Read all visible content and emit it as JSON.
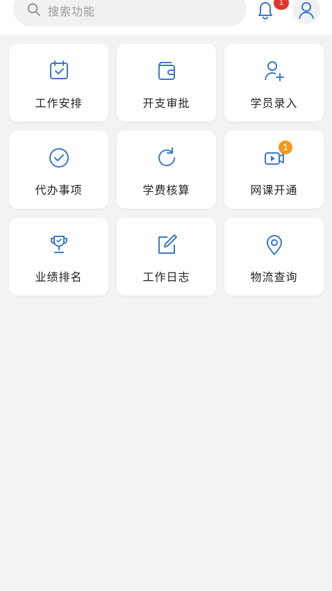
{
  "header": {
    "search_placeholder": "搜索功能",
    "notification_badge": "1"
  },
  "colors": {
    "accent": "#3a78c9",
    "badge_red": "#e5352b",
    "badge_orange": "#f39a1e"
  },
  "menu": {
    "items": [
      {
        "label": "工作安排",
        "icon": "calendar-icon"
      },
      {
        "label": "开支审批",
        "icon": "wallet-icon"
      },
      {
        "label": "学员录入",
        "icon": "add-user-icon"
      },
      {
        "label": "代办事项",
        "icon": "check-circle-icon"
      },
      {
        "label": "学费核算",
        "icon": "refresh-icon"
      },
      {
        "label": "网课开通",
        "icon": "video-icon",
        "badge": "1"
      },
      {
        "label": "业绩排名",
        "icon": "trophy-icon"
      },
      {
        "label": "工作日志",
        "icon": "edit-icon"
      },
      {
        "label": "物流查询",
        "icon": "location-icon"
      }
    ]
  }
}
